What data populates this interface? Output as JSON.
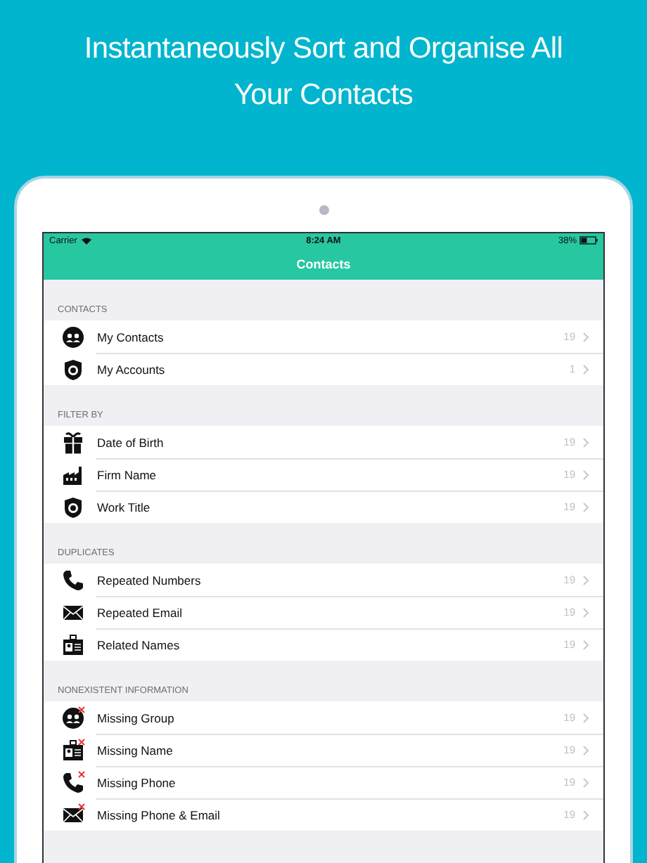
{
  "headline": [
    "Instantaneously Sort and Organise All",
    "Your Contacts"
  ],
  "status_bar": {
    "carrier": "Carrier",
    "time": "8:24 AM",
    "battery": "38%"
  },
  "nav": {
    "title": "Contacts"
  },
  "sections": [
    {
      "header": "CONTACTS",
      "rows": [
        {
          "label": "My Contacts",
          "count": "19"
        },
        {
          "label": "My Accounts",
          "count": "1"
        }
      ]
    },
    {
      "header": "FILTER BY",
      "rows": [
        {
          "label": "Date of Birth",
          "count": "19"
        },
        {
          "label": "Firm Name",
          "count": "19"
        },
        {
          "label": "Work Title",
          "count": "19"
        }
      ]
    },
    {
      "header": "DUPLICATES",
      "rows": [
        {
          "label": "Repeated Numbers",
          "count": "19"
        },
        {
          "label": "Repeated Email",
          "count": "19"
        },
        {
          "label": "Related Names",
          "count": "19"
        }
      ]
    },
    {
      "header": "NONEXISTENT INFORMATION",
      "rows": [
        {
          "label": "Missing Group",
          "count": "19"
        },
        {
          "label": "Missing Name",
          "count": "19"
        },
        {
          "label": "Missing Phone",
          "count": "19"
        },
        {
          "label": "Missing Phone & Email",
          "count": "19"
        }
      ]
    }
  ]
}
